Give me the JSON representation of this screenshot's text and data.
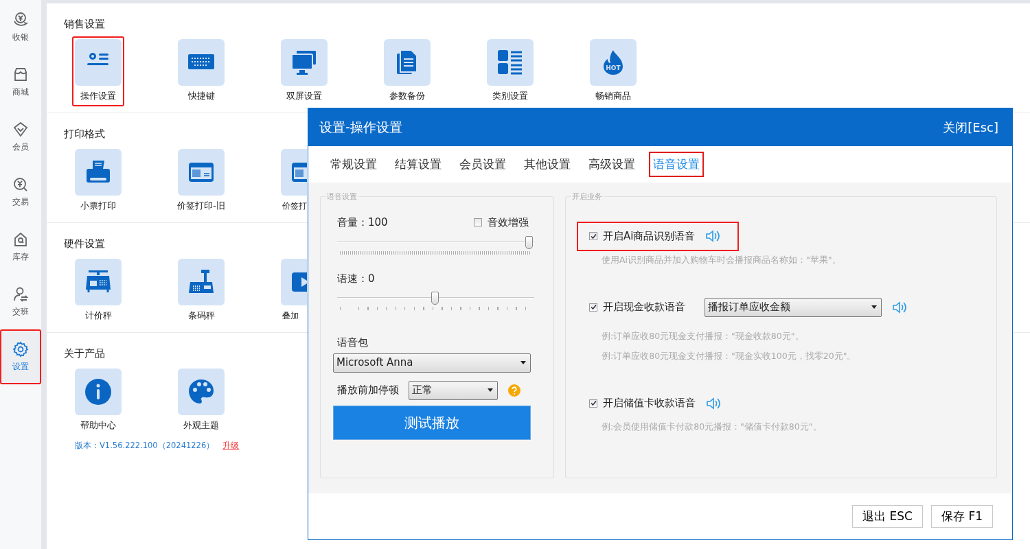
{
  "sidebar": {
    "items": [
      {
        "label": "收银",
        "selected": false,
        "highlighted": false
      },
      {
        "label": "商城",
        "selected": false,
        "highlighted": false
      },
      {
        "label": "会员",
        "selected": false,
        "highlighted": false
      },
      {
        "label": "交易",
        "selected": false,
        "highlighted": false
      },
      {
        "label": "库存",
        "selected": false,
        "highlighted": false
      },
      {
        "label": "交班",
        "selected": false,
        "highlighted": false
      },
      {
        "label": "设置",
        "selected": true,
        "highlighted": true
      }
    ]
  },
  "sections": [
    {
      "title": "销售设置",
      "items": [
        {
          "label": "操作设置",
          "highlighted": true,
          "cut": false
        },
        {
          "label": "快捷键",
          "highlighted": false,
          "cut": false
        },
        {
          "label": "双屏设置",
          "highlighted": false,
          "cut": false
        },
        {
          "label": "参数备份",
          "highlighted": false,
          "cut": false
        },
        {
          "label": "类别设置",
          "highlighted": false,
          "cut": false
        },
        {
          "label": "畅销商品",
          "highlighted": false,
          "cut": false,
          "icon_text": "HOT"
        }
      ]
    },
    {
      "title": "打印格式",
      "items": [
        {
          "label": "小票打印",
          "highlighted": false,
          "cut": false
        },
        {
          "label": "价签打印-旧",
          "highlighted": false,
          "cut": false
        },
        {
          "label": "价签打",
          "highlighted": false,
          "cut": true
        }
      ]
    },
    {
      "title": "硬件设置",
      "items": [
        {
          "label": "计价秤",
          "highlighted": false,
          "cut": false
        },
        {
          "label": "条码秤",
          "highlighted": false,
          "cut": false
        },
        {
          "label": "叠加",
          "highlighted": false,
          "cut": true
        }
      ]
    },
    {
      "title": "关于产品",
      "items": [
        {
          "label": "帮助中心",
          "highlighted": false,
          "cut": false
        },
        {
          "label": "外观主题",
          "highlighted": false,
          "cut": false
        }
      ]
    }
  ],
  "version": {
    "text": "版本：V1.56.222.100（20241226）",
    "link": "升级"
  },
  "dialog": {
    "title": "设置-操作设置",
    "close": "关闭[Esc]",
    "tabs": [
      {
        "label": "常规设置",
        "selected": false,
        "highlighted": false
      },
      {
        "label": "结算设置",
        "selected": false,
        "highlighted": false
      },
      {
        "label": "会员设置",
        "selected": false,
        "highlighted": false
      },
      {
        "label": "其他设置",
        "selected": false,
        "highlighted": false
      },
      {
        "label": "高级设置",
        "selected": false,
        "highlighted": false
      },
      {
        "label": "语音设置",
        "selected": true,
        "highlighted": true
      }
    ],
    "voice_settings": {
      "legend": "语音设置",
      "volume": {
        "label": "音量：100",
        "level": 1
      },
      "enhance": {
        "label": "音效增强",
        "checked": false
      },
      "speed": {
        "label": "语速：0",
        "level": 0.5
      },
      "pack_label": "语音包",
      "pack": "Microsoft Anna",
      "pause_label": "播放前加停顿",
      "pause": "正常",
      "test_button": "测试播放"
    },
    "business": {
      "legend": "开启业务",
      "options": [
        {
          "label": "开启Ai商品识别语音",
          "checked": true,
          "highlighted": true,
          "notes": [
            "使用Ai识别商品并加入购物车时会播报商品名称如：\"苹果\"。"
          ]
        },
        {
          "label": "开启现金收款语音",
          "checked": true,
          "highlighted": false,
          "select": "播报订单应收金额",
          "notes": [
            "例:订单应收80元现金支付播报：\"现金收款80元\"。",
            "例:订单应收80元现金支付播报：\"现金实收100元，找零20元\"。"
          ]
        },
        {
          "label": "开启储值卡收款语音",
          "checked": true,
          "highlighted": false,
          "notes": [
            "例:会员使用储值卡付款80元播报：\"储值卡付款80元\"。"
          ]
        }
      ]
    },
    "buttons": [
      "退出 ESC",
      "保存 F1"
    ]
  }
}
